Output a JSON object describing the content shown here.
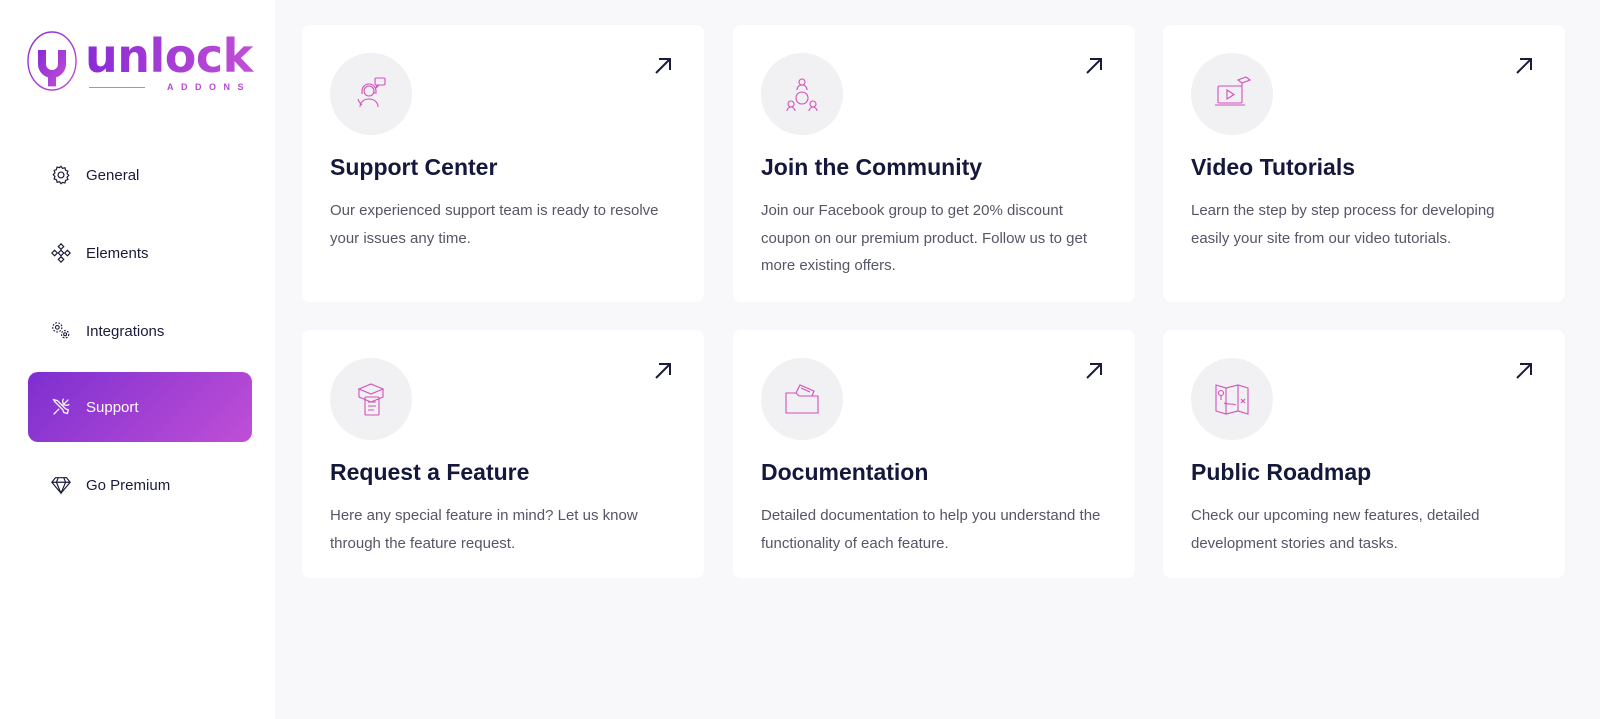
{
  "brand": {
    "name": "unlock",
    "subtitle": "ADDONS",
    "accent": "#9b3bd6",
    "icon": "unlock-logo-icon"
  },
  "sidebar": {
    "items": [
      {
        "label": "General",
        "icon": "gear-icon",
        "active": false
      },
      {
        "label": "Elements",
        "icon": "elements-icon",
        "active": false
      },
      {
        "label": "Integrations",
        "icon": "integrations-icon",
        "active": false
      },
      {
        "label": "Support",
        "icon": "tools-icon",
        "active": true
      },
      {
        "label": "Go Premium",
        "icon": "diamond-icon",
        "active": false
      }
    ]
  },
  "cards": [
    {
      "title": "Support Center",
      "description": "Our experienced support team is ready to resolve your issues any time.",
      "icon": "support-agent-icon"
    },
    {
      "title": "Join the Community",
      "description": "Join our Facebook group to get 20% discount coupon on our premium product. Follow us to get more existing offers.",
      "icon": "community-icon"
    },
    {
      "title": "Video Tutorials",
      "description": "Learn the step by step process for developing easily your site from our video tutorials.",
      "icon": "video-tutorial-icon"
    },
    {
      "title": "Request a Feature",
      "description": "Here any special feature in mind? Let us know through the feature request.",
      "icon": "feature-request-icon"
    },
    {
      "title": "Documentation",
      "description": "Detailed documentation to help you understand the functionality of each feature.",
      "icon": "folder-docs-icon"
    },
    {
      "title": "Public Roadmap",
      "description": "Check our upcoming new features, detailed development stories and tasks.",
      "icon": "roadmap-map-icon"
    }
  ],
  "colors": {
    "accent_start": "#7d2fd0",
    "accent_end": "#c04fd6",
    "icon_pink": "#d24fbe",
    "text_dark": "#14183a",
    "background": "#f8f8fa"
  }
}
